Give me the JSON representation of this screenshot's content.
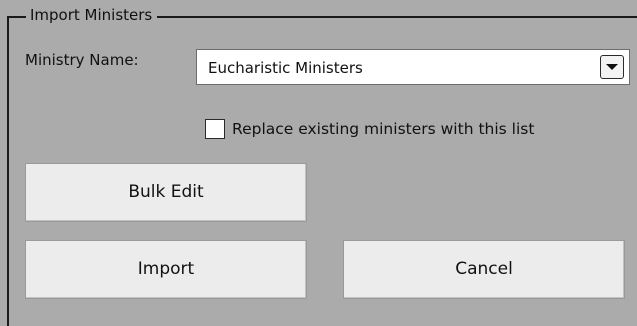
{
  "group": {
    "title": "Import Ministers"
  },
  "ministry": {
    "label": "Ministry Name:",
    "selected_value": "Eucharistic Ministers",
    "dropdown_icon": "chevron-down-icon"
  },
  "replace_option": {
    "label": "Replace existing ministers with this list",
    "checked": false
  },
  "buttons": {
    "bulk_edit": "Bulk Edit",
    "import": "Import",
    "cancel": "Cancel"
  },
  "colors": {
    "background": "#ababab",
    "button_face": "#ececec",
    "field_background": "#ffffff"
  }
}
